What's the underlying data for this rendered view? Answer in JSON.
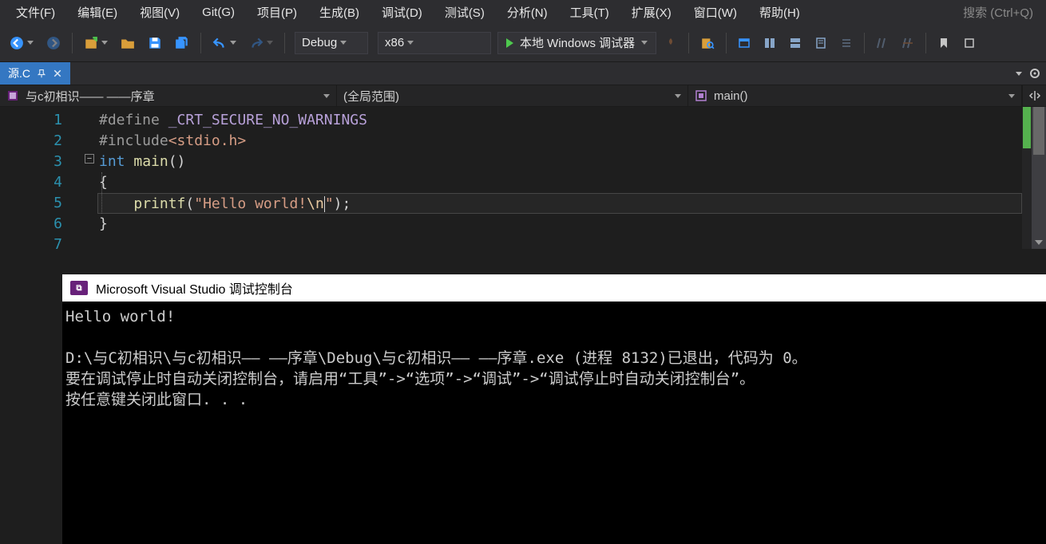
{
  "menubar": {
    "items": [
      "文件(F)",
      "编辑(E)",
      "视图(V)",
      "Git(G)",
      "项目(P)",
      "生成(B)",
      "调试(D)",
      "测试(S)",
      "分析(N)",
      "工具(T)",
      "扩展(X)",
      "窗口(W)",
      "帮助(H)"
    ],
    "search_placeholder": "搜索 (Ctrl+Q)"
  },
  "toolbar": {
    "config": "Debug",
    "platform": "x86",
    "run_label": "本地 Windows 调试器"
  },
  "tabs": {
    "active_file": "源.C"
  },
  "nav": {
    "scope1": "与c初相识—— ——序章",
    "scope2": "(全局范围)",
    "scope3": "main()"
  },
  "editor": {
    "lines": {
      "l1_pp": "#define ",
      "l1_macro": "_CRT_SECURE_NO_WARNINGS",
      "l2_pp": "#include",
      "l2_inc": "<stdio.h>",
      "l3_kw": "int ",
      "l3_fn": "main",
      "l3_paren": "()",
      "l4_brace": "{",
      "l5_indent": "    ",
      "l5_fn": "printf",
      "l5_open": "(",
      "l5_str1": "\"Hello world!",
      "l5_esc": "\\n",
      "l5_str2": "\"",
      "l5_close": ");",
      "l6_brace": "}"
    },
    "line_numbers": [
      "1",
      "2",
      "3",
      "4",
      "5",
      "6",
      "7"
    ]
  },
  "console": {
    "title": "Microsoft Visual Studio 调试控制台",
    "output": "Hello world!\n\nD:\\与C初相识\\与c初相识—— ——序章\\Debug\\与c初相识—— ——序章.exe (进程 8132)已退出，代码为 0。\n要在调试停止时自动关闭控制台，请启用“工具”->“选项”->“调试”->“调试停止时自动关闭控制台”。\n按任意键关闭此窗口. . ."
  }
}
